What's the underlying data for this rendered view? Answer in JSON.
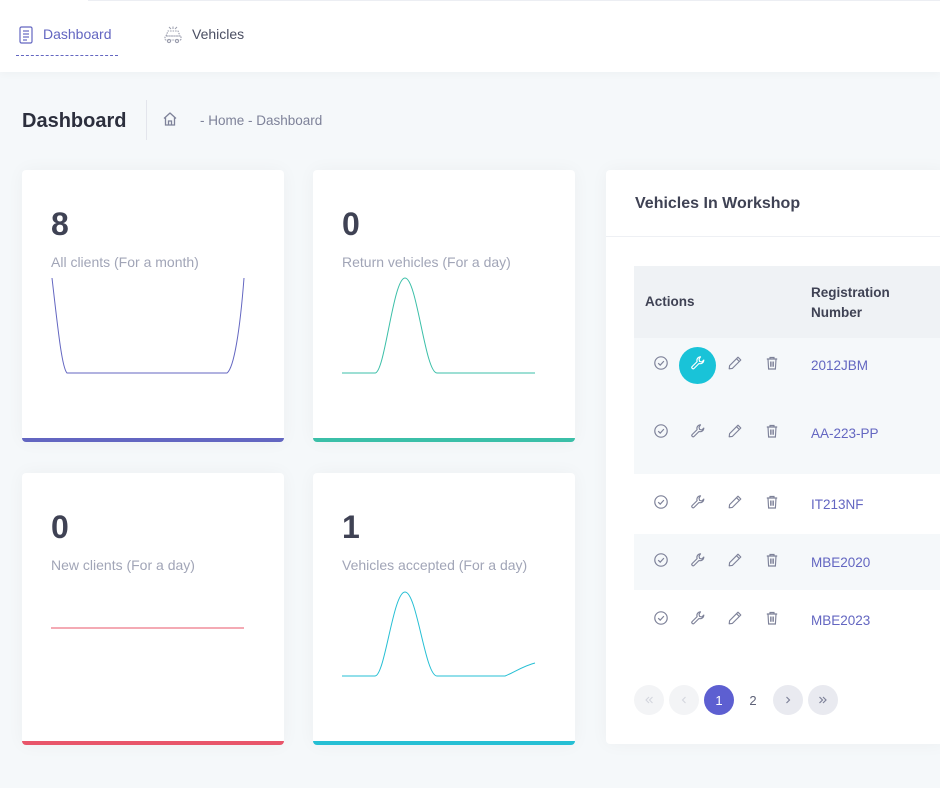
{
  "nav": {
    "items": [
      {
        "label": "Dashboard",
        "icon": "document-icon",
        "active": true
      },
      {
        "label": "Vehicles",
        "icon": "car-icon",
        "active": false
      }
    ]
  },
  "page": {
    "title": "Dashboard",
    "breadcrumb": "- Home - Dashboard"
  },
  "stats": [
    {
      "value": "8",
      "label": "All clients (For a month)",
      "color": "#6366c1"
    },
    {
      "value": "0",
      "label": "Return vehicles (For a day)",
      "color": "#3bbfa8"
    },
    {
      "value": "0",
      "label": "New clients (For a day)",
      "color": "#e8556a"
    },
    {
      "value": "1",
      "label": "Vehicles accepted (For a day)",
      "color": "#26bfd4"
    }
  ],
  "workshop": {
    "title": "Vehicles In Workshop",
    "columns": {
      "actions": "Actions",
      "registration": "Registration Number"
    },
    "rows": [
      {
        "registration": "2012JBM"
      },
      {
        "registration": "AA-223-PP"
      },
      {
        "registration": "IT213NF"
      },
      {
        "registration": "MBE2020"
      },
      {
        "registration": "MBE2023"
      }
    ],
    "action_icons": [
      "check-circle-icon",
      "wrench-icon",
      "pencil-icon",
      "trash-icon"
    ],
    "pagination": {
      "current_page": "1",
      "next_page": "2"
    }
  },
  "colors": {
    "accent": "#6366c1",
    "teal": "#3bbfa8",
    "red": "#e8556a",
    "cyan": "#26bfd4",
    "highlight_action": "#19c3d8"
  }
}
